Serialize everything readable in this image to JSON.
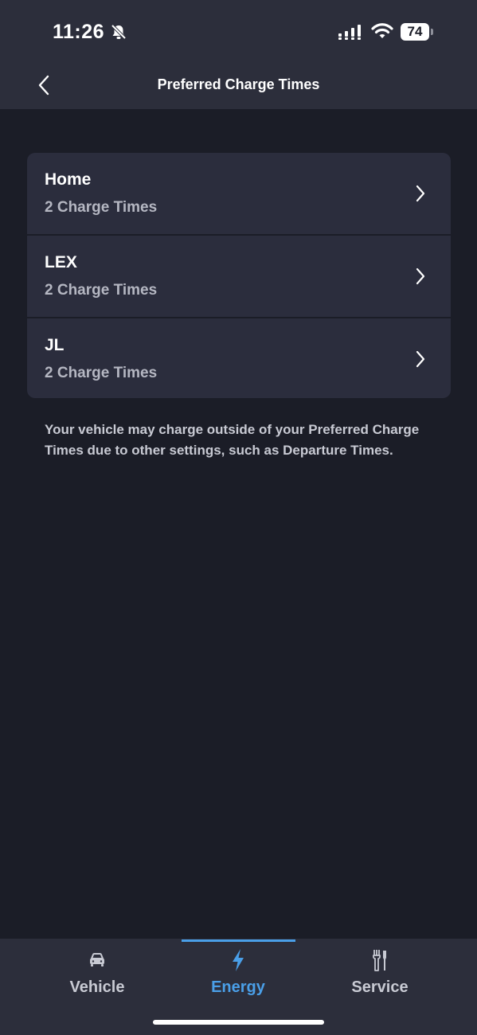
{
  "status_bar": {
    "time": "11:26",
    "battery": "74"
  },
  "header": {
    "title": "Preferred Charge Times"
  },
  "locations": [
    {
      "name": "Home",
      "subtitle": "2 Charge Times"
    },
    {
      "name": "LEX",
      "subtitle": "2 Charge Times"
    },
    {
      "name": "JL",
      "subtitle": "2 Charge Times"
    }
  ],
  "note": "Your vehicle may charge outside of your Preferred Charge Times due to other settings, such as Departure Times.",
  "tabs": [
    {
      "label": "Vehicle",
      "icon": "car-icon",
      "active": false
    },
    {
      "label": "Energy",
      "icon": "lightning-bolt-icon",
      "active": true
    },
    {
      "label": "Service",
      "icon": "tools-icon",
      "active": false
    }
  ],
  "colors": {
    "background": "#1b1d27",
    "surface": "#2c2e3b",
    "card": "#2b2d3d",
    "accent": "#4a9fe8",
    "text_primary": "#ffffff",
    "text_secondary": "#b5b7c2"
  }
}
